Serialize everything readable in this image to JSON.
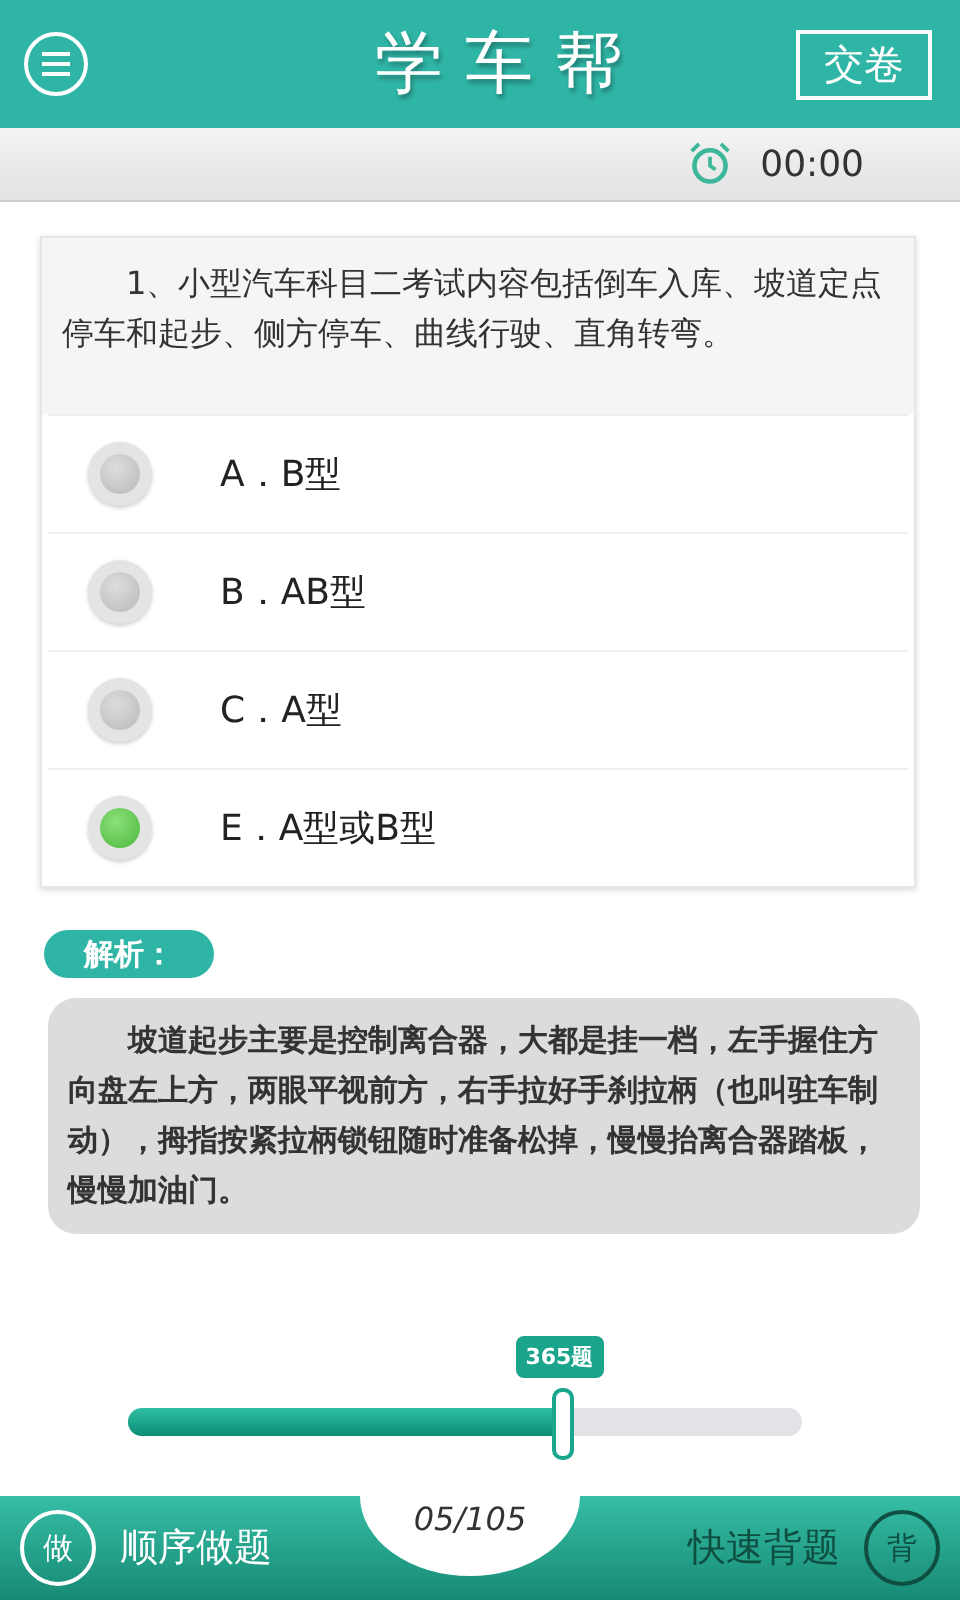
{
  "header": {
    "title": "学 车 帮",
    "submit_button": "交卷"
  },
  "timer": "00:00",
  "question": {
    "text": "1、小型汽车科目二考试内容包括倒车入库、坡道定点停车和起步、侧方停车、曲线行驶、直角转弯。",
    "options": [
      {
        "label": "A．B型",
        "selected": false
      },
      {
        "label": "B．AB型",
        "selected": false
      },
      {
        "label": "C．A型",
        "selected": false
      },
      {
        "label": "E．A型或B型",
        "selected": true
      }
    ]
  },
  "analysis": {
    "label": "解析：",
    "text": "坡道起步主要是控制离合器，大都是挂一档，左手握住方向盘左上方，两眼平视前方，右手拉好手刹拉柄（也叫驻车制动），拇指按紧拉柄锁钮随时准备松掉，慢慢抬离合器踏板，慢慢加油门。"
  },
  "slider": {
    "level": 0.64,
    "tooltip": "365题"
  },
  "bottom_bar": {
    "left": {
      "icon_text": "做",
      "label": "顺序做题"
    },
    "progress": "05/105",
    "right": {
      "label": "快速背题",
      "icon_text": "背"
    }
  }
}
